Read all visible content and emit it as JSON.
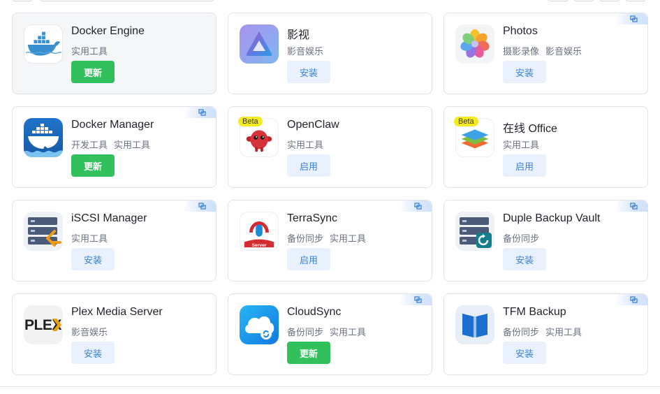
{
  "apps": [
    {
      "name": "Docker Engine",
      "tags": [
        "实用工具"
      ],
      "button": "更新",
      "icon": "docker-whale-icon"
    },
    {
      "name": "影视",
      "tags": [
        "影音娱乐"
      ],
      "button": "安装",
      "icon": "jellyfin-icon"
    },
    {
      "name": "Photos",
      "tags": [
        "摄影录像",
        "影音娱乐"
      ],
      "button": "安装",
      "icon": "photos-flower-icon"
    },
    {
      "name": "Docker Manager",
      "tags": [
        "开发工具",
        "实用工具"
      ],
      "button": "更新",
      "icon": "docker-manager-icon"
    },
    {
      "name": "OpenClaw",
      "tags": [
        "实用工具"
      ],
      "button": "启用",
      "icon": "openclaw-creature-icon",
      "beta": "Beta"
    },
    {
      "name": "在线 Office",
      "tags": [
        "实用工具"
      ],
      "button": "启用",
      "icon": "office-stack-icon",
      "beta": "Beta"
    },
    {
      "name": "iSCSI Manager",
      "tags": [
        "实用工具"
      ],
      "button": "安装",
      "icon": "iscsi-server-icon"
    },
    {
      "name": "TerraSync",
      "tags": [
        "备份同步",
        "实用工具"
      ],
      "button": "启用",
      "icon": "terrasync-icon",
      "icon_text": "Server"
    },
    {
      "name": "Duple Backup Vault",
      "tags": [
        "备份同步"
      ],
      "button": "安装",
      "icon": "backup-vault-icon"
    },
    {
      "name": "Plex Media Server",
      "tags": [
        "影音娱乐"
      ],
      "button": "安装",
      "icon": "plex-logo-icon",
      "icon_text": "PLEX"
    },
    {
      "name": "CloudSync",
      "tags": [
        "备份同步",
        "实用工具"
      ],
      "button": "更新",
      "icon": "cloudsync-icon"
    },
    {
      "name": "TFM Backup",
      "tags": [
        "备份同步",
        "实用工具"
      ],
      "button": "安装",
      "icon": "tfm-backup-icon"
    }
  ],
  "colors": {
    "update": "#32c05c",
    "install_bg": "#e8f1fd",
    "install_text": "#3b82d9",
    "beta": "#f5ea1f"
  }
}
